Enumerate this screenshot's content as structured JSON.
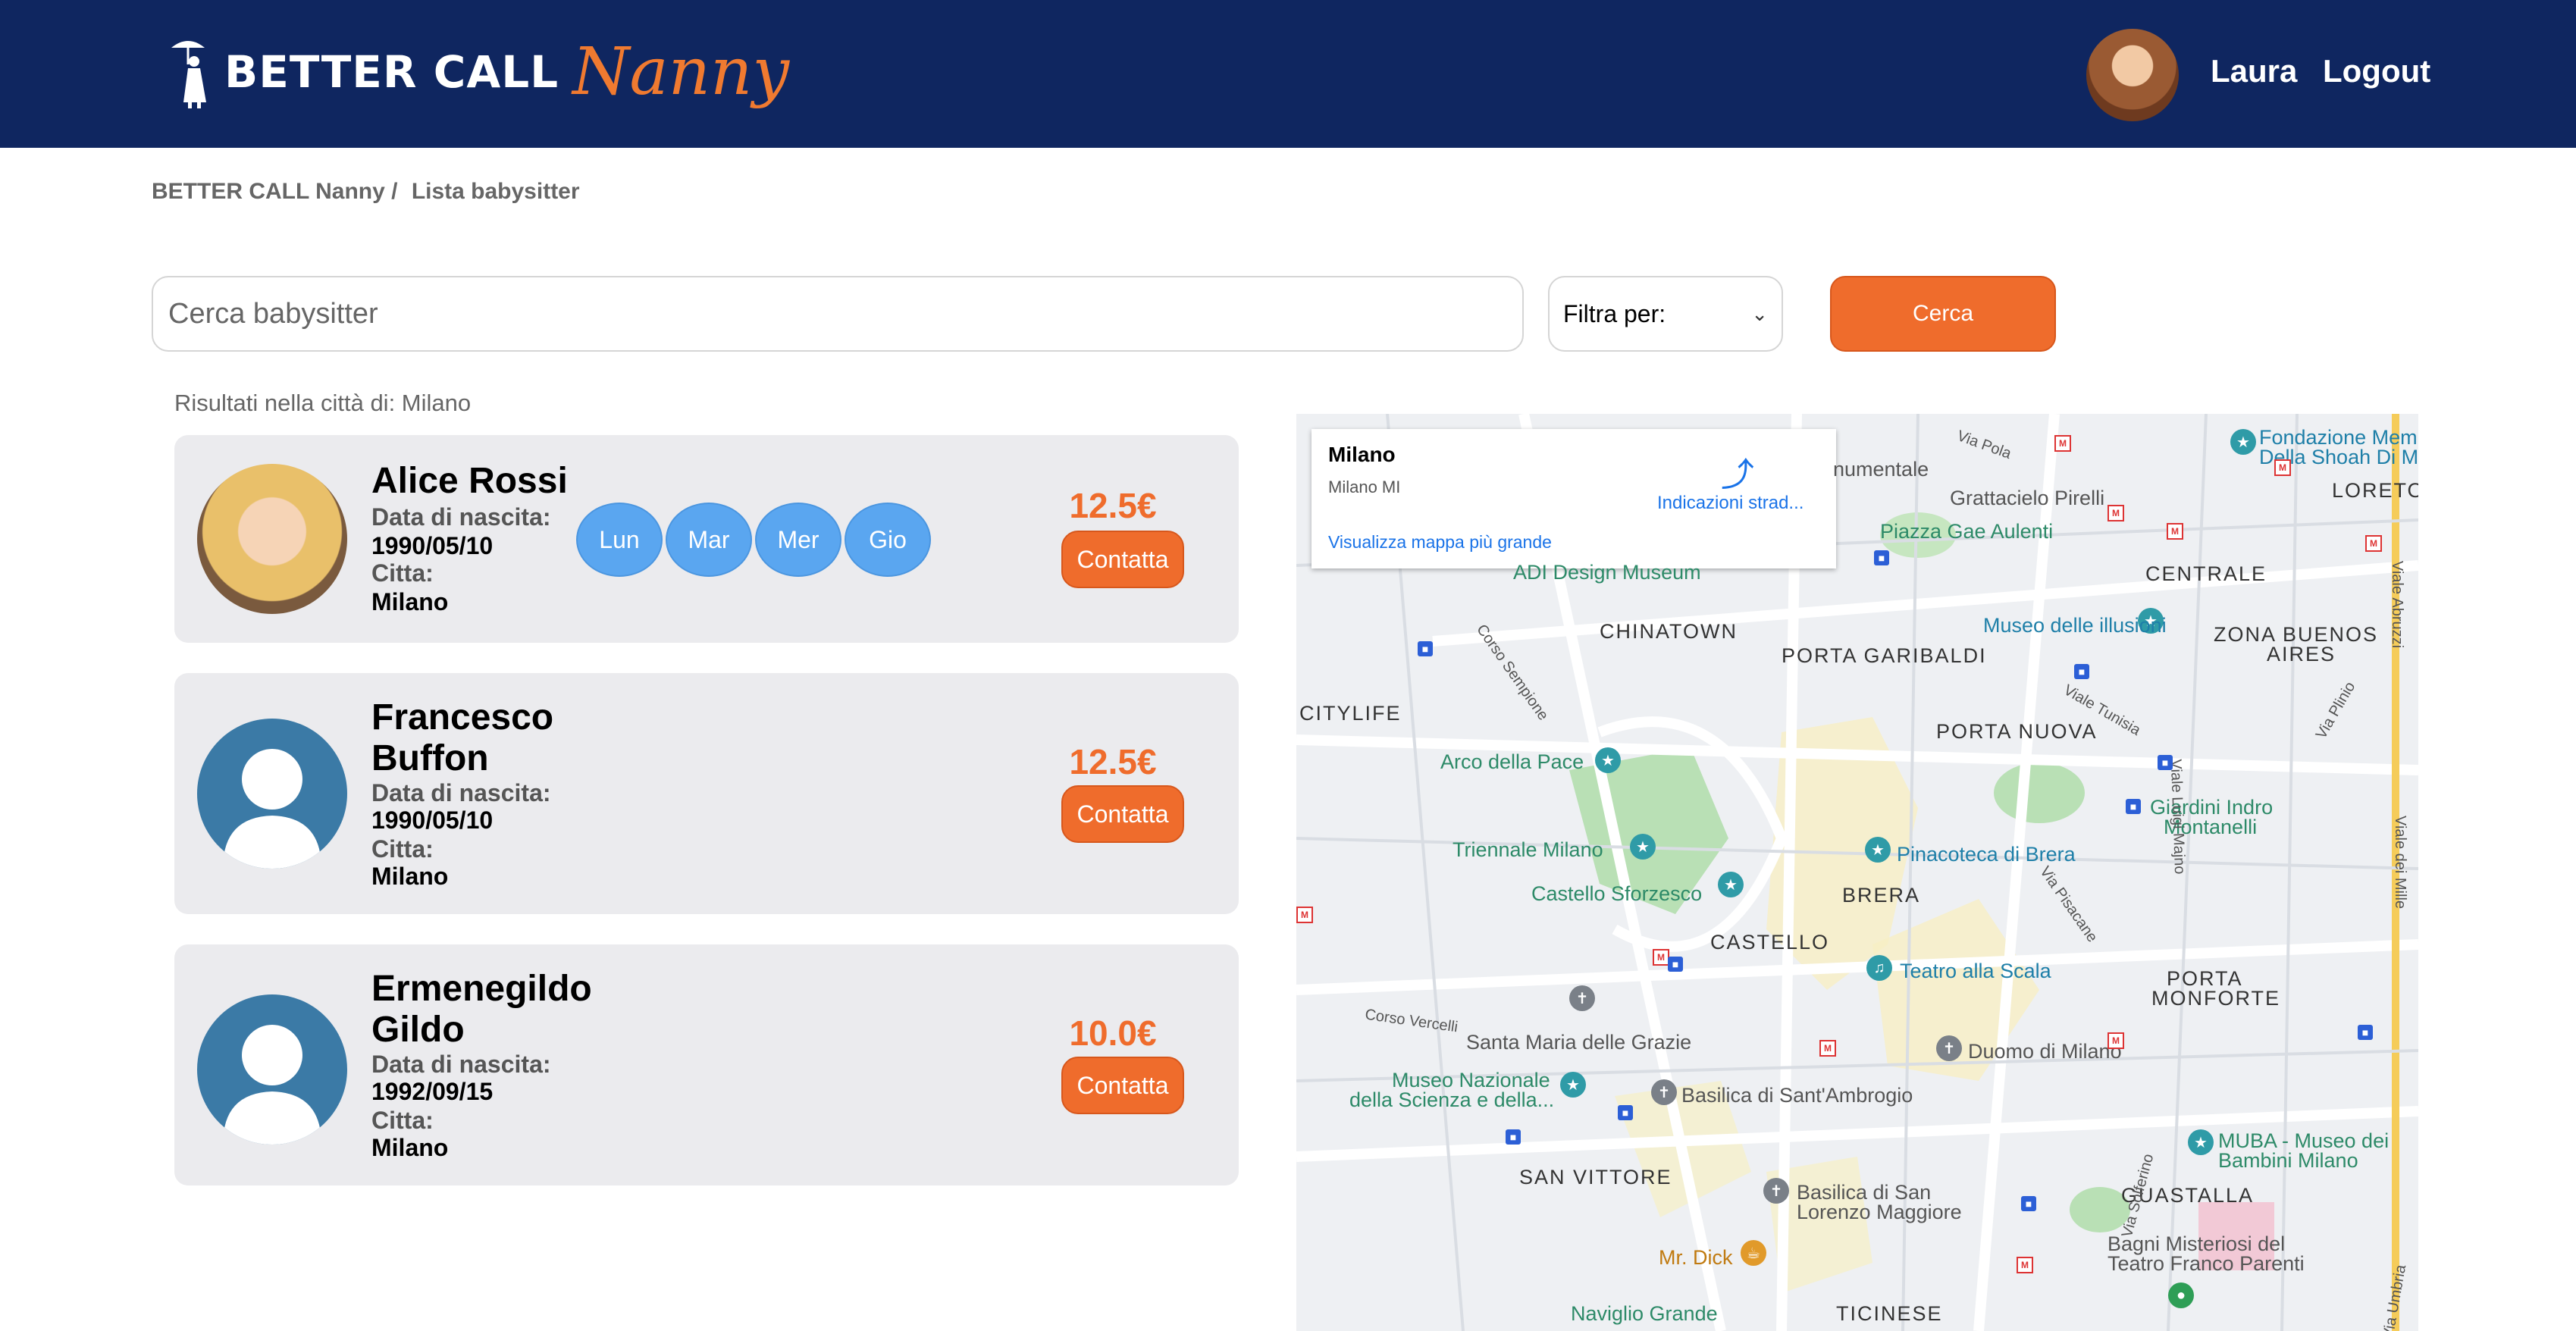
{
  "header": {
    "brand_main": "BETTER CALL",
    "brand_script": "Nanny",
    "user_name": "Laura",
    "logout_label": "Logout"
  },
  "breadcrumb": {
    "home": "BETTER CALL Nanny /",
    "current": "Lista babysitter"
  },
  "search": {
    "placeholder": "Cerca babysitter",
    "filter_label": "Filtra per:",
    "button_label": "Cerca"
  },
  "results": {
    "label": "Risultati nella città di: Milano"
  },
  "babysitters": [
    {
      "name": "Alice Rossi",
      "birth_label": "Data di nascita:",
      "birth_date": "1990/05/10",
      "city_label": "Citta:",
      "city": "Milano",
      "days": [
        "Lun",
        "Mar",
        "Mer",
        "Gio"
      ],
      "price": "12.5€",
      "contact_label": "Contatta"
    },
    {
      "name": "Francesco Buffon",
      "birth_label": "Data di nascita:",
      "birth_date": "1990/05/10",
      "city_label": "Citta:",
      "city": "Milano",
      "price": "12.5€",
      "contact_label": "Contatta"
    },
    {
      "name": "Ermenegildo Gildo",
      "birth_label": "Data di nascita:",
      "birth_date": "1992/09/15",
      "city_label": "Citta:",
      "city": "Milano",
      "price": "10.0€",
      "contact_label": "Contatta"
    }
  ],
  "map": {
    "info_city": "Milano",
    "info_sub": "Milano MI",
    "directions_label": "Indicazioni strad...",
    "bigger_map_label": "Visualizza mappa più grande",
    "districts": [
      "CHINATOWN",
      "PORTA GARIBALDI",
      "CENTRALE",
      "ZONA BUENOS",
      "AIRES",
      "LORETO",
      "CITYLIFE",
      "PORTA NUOVA",
      "BRERA",
      "CASTELLO",
      "PORTA",
      "MONFORTE",
      "SAN VITTORE",
      "GUASTALLA",
      "TICINESE"
    ],
    "pois": [
      "Fondazione Mem",
      "Della Shoah Di M",
      "numentale",
      "Grattacielo Pirelli",
      "Piazza Gae Aulenti",
      "ADI Design Museum",
      "Museo delle illusioni",
      "Arco della Pace",
      "Giardini Indro",
      "Montanelli",
      "Triennale Milano",
      "Pinacoteca di Brera",
      "Castello Sforzesco",
      "Teatro alla Scala",
      "Santa Maria delle Grazie",
      "Duomo di Milano",
      "Museo Nazionale",
      "della Scienza e della...",
      "Basilica di Sant'Ambrogio",
      "MUBA - Museo dei",
      "Bambini Milano",
      "Basilica di San",
      "Lorenzo Maggiore",
      "Mr. Dick",
      "Bagni Misteriosi del",
      "Teatro Franco Parenti",
      "Naviglio Grande"
    ],
    "streets": [
      "Via Pola",
      "Corso Sempione",
      "Viale Tunisia",
      "Via Pisacane",
      "Via Solferino",
      "Viale Luigi Majno",
      "Corso Vercelli",
      "Viale Abruzzi",
      "Viale dei Mille",
      "Via Plinio",
      "Via Umbria"
    ]
  }
}
